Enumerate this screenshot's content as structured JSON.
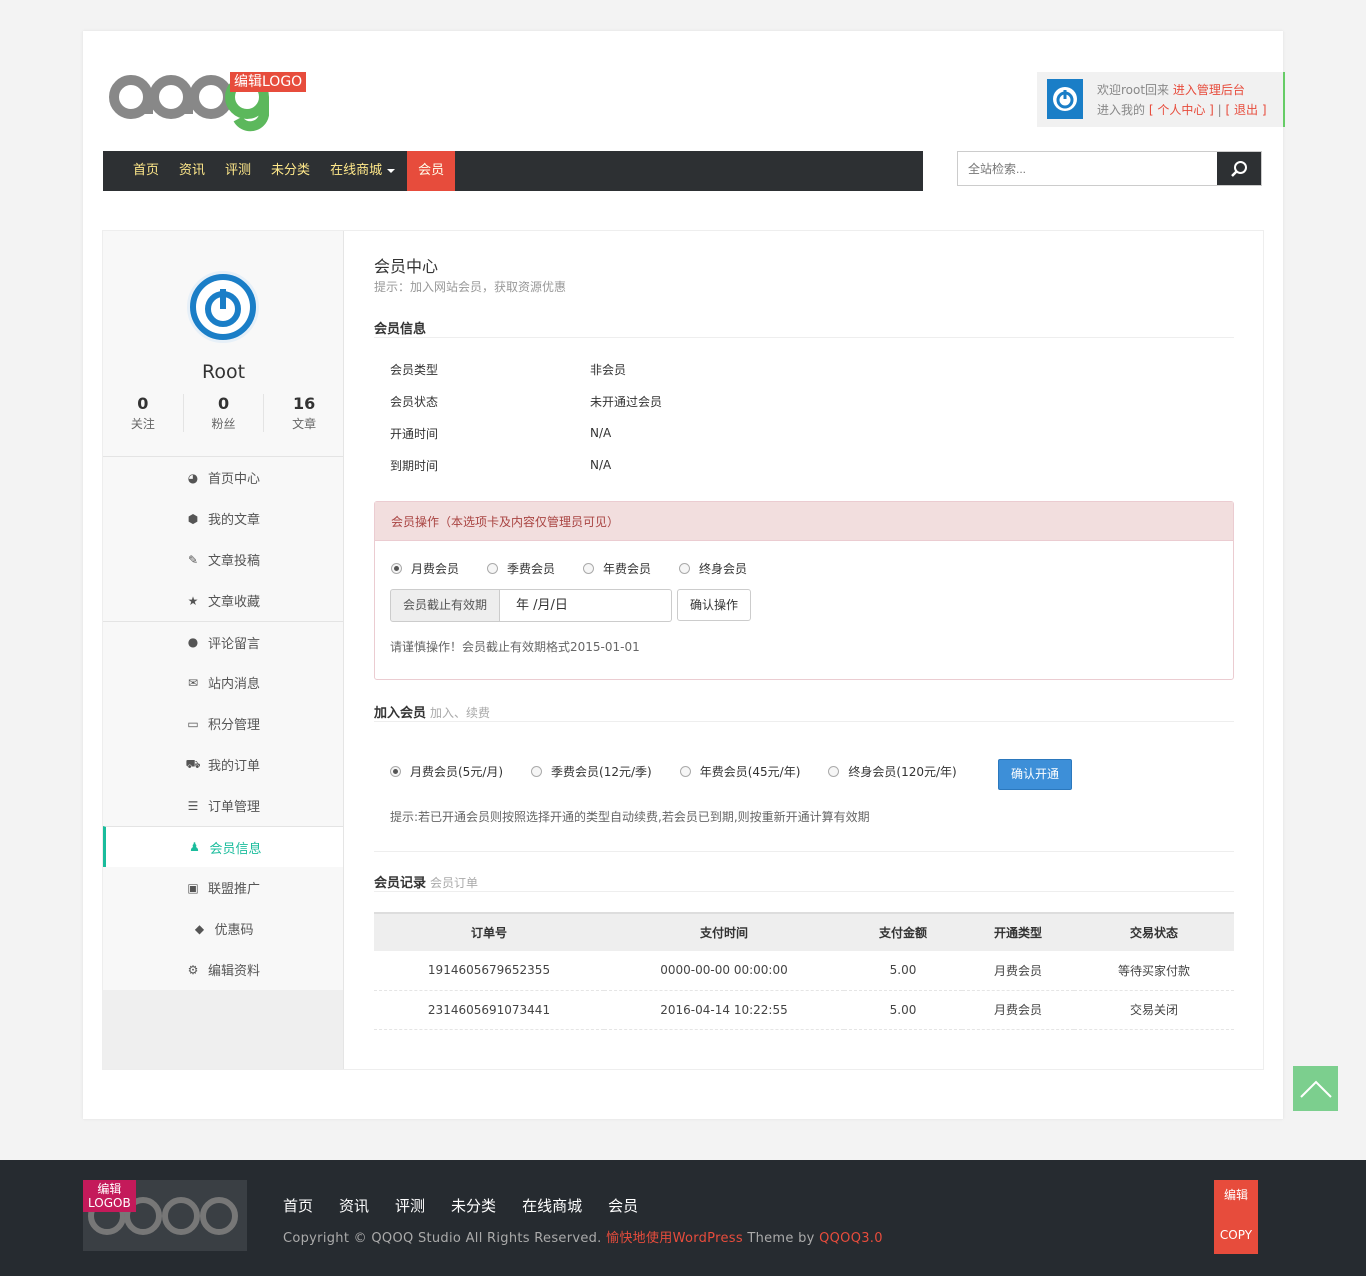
{
  "header": {
    "logo_badge": "编辑LOGO",
    "user": {
      "welcome": "欢迎root回来",
      "admin_link": "进入管理后台",
      "enter_my": "进入我的",
      "center_link": "[ 个人中心 ]",
      "sep": "|",
      "logout_link": "[ 退出 ]"
    },
    "nav": [
      "首页",
      "资讯",
      "评测",
      "未分类",
      "在线商城",
      "会员"
    ],
    "search_placeholder": "全站检索..."
  },
  "sidebar": {
    "name": "Root",
    "stats": [
      {
        "value": "0",
        "label": "关注"
      },
      {
        "value": "0",
        "label": "粉丝"
      },
      {
        "value": "16",
        "label": "文章"
      }
    ],
    "menu": [
      {
        "label": "首页中心",
        "icon": "dashboard-icon"
      },
      {
        "label": "我的文章",
        "icon": "cube-icon"
      },
      {
        "label": "文章投稿",
        "icon": "edit-icon"
      },
      {
        "label": "文章收藏",
        "icon": "star-icon"
      },
      {
        "label": "评论留言",
        "icon": "comments-icon"
      },
      {
        "label": "站内消息",
        "icon": "envelope-icon"
      },
      {
        "label": "积分管理",
        "icon": "credit-card-icon"
      },
      {
        "label": "我的订单",
        "icon": "cart-icon"
      },
      {
        "label": "订单管理",
        "icon": "list-icon"
      },
      {
        "label": "会员信息",
        "icon": "user-icon"
      },
      {
        "label": "联盟推广",
        "icon": "money-icon"
      },
      {
        "label": "优惠码",
        "icon": "tags-icon"
      },
      {
        "label": "编辑资料",
        "icon": "cog-icon"
      }
    ]
  },
  "main": {
    "title": "会员中心",
    "tip": "提示：加入网站会员，获取资源优惠",
    "info_title": "会员信息",
    "info_rows": [
      {
        "k": "会员类型",
        "v": "非会员"
      },
      {
        "k": "会员状态",
        "v": "未开通过会员"
      },
      {
        "k": "开通时间",
        "v": "N/A"
      },
      {
        "k": "到期时间",
        "v": "N/A"
      }
    ],
    "ops": {
      "header": "会员操作（本选项卡及内容仅管理员可见）",
      "radios": [
        "月费会员",
        "季费会员",
        "年费会员",
        "终身会员"
      ],
      "addon": "会员截止有效期",
      "date_value": "年 /月/日",
      "confirm": "确认操作",
      "note": "请谨慎操作！会员截止有效期格式2015-01-01"
    },
    "join": {
      "title": "加入会员",
      "sub": "加入、续费",
      "radios": [
        "月费会员(5元/月)",
        "季费会员(12元/季)",
        "年费会员(45元/年)",
        "终身会员(120元/年)"
      ],
      "button": "确认开通",
      "note": "提示:若已开通会员则按照选择开通的类型自动续费,若会员已到期,则按重新开通计算有效期"
    },
    "records": {
      "title": "会员记录",
      "sub": "会员订单",
      "headers": [
        "订单号",
        "支付时间",
        "支付金额",
        "开通类型",
        "交易状态"
      ],
      "rows": [
        [
          "1914605679652355",
          "0000-00-00 00:00:00",
          "5.00",
          "月费会员",
          "等待买家付款"
        ],
        [
          "2314605691073441",
          "2016-04-14 10:22:55",
          "5.00",
          "月费会员",
          "交易关闭"
        ]
      ]
    }
  },
  "footer": {
    "logo_badge": "编辑\nLOGOB",
    "nav": [
      "首页",
      "资讯",
      "评测",
      "未分类",
      "在线商城",
      "会员"
    ],
    "copy_prefix": "Copyright © QQOQ Studio All Rights Reserved.",
    "copy_link": "愉快地使用WordPress",
    "copy_mid": "Theme by",
    "copy_theme": "QQOQ3.0",
    "edit_label": "编辑",
    "copy_label": "COPY"
  },
  "colors": {
    "accent": "#e74c3c",
    "active": "#1abc9c",
    "nav_bg": "#2d3033",
    "button_blue": "#3d8fd8"
  }
}
